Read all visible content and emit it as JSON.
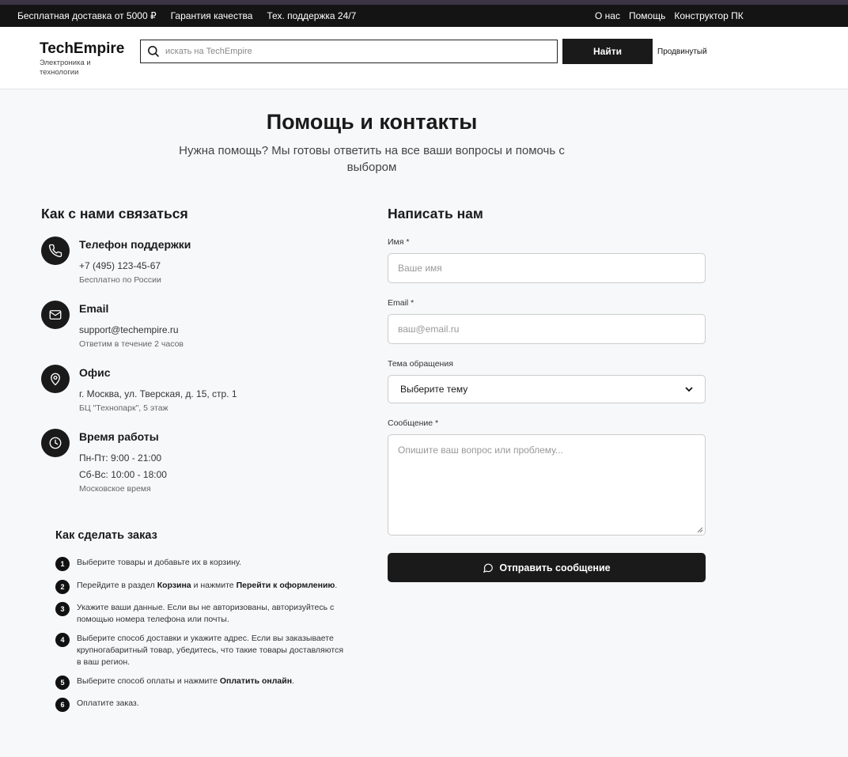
{
  "topbar": {
    "links_left": [
      "Бесплатная доставка от 5000 ₽",
      "Гарантия качества",
      "Тех. поддержка 24/7"
    ],
    "links_right": [
      "О нас",
      "Помощь",
      "Конструктор ПК"
    ]
  },
  "header": {
    "logo": "TechEmpire",
    "tagline": "Электроника и технологии",
    "search_placeholder": "искать на TechEmpire",
    "search_button": "Найти",
    "advanced_link": "Продвинутый"
  },
  "page": {
    "title": "Помощь и контакты",
    "subtitle": "Нужна помощь? Мы готовы ответить на все ваши вопросы и помочь с выбором"
  },
  "contacts": {
    "heading": "Как с нами связаться",
    "phone": {
      "icon": "phone-icon",
      "title": "Телефон поддержки",
      "value": "+7 (495) 123-45-67",
      "note": "Бесплатно по России"
    },
    "email": {
      "icon": "mail-icon",
      "title": "Email",
      "value": "support@techempire.ru",
      "note": "Ответим в течение 2 часов"
    },
    "office": {
      "icon": "map-pin-icon",
      "title": "Офис",
      "value": "г. Москва, ул. Тверская, д. 15, стр. 1",
      "note": "БЦ \"Технопарк\", 5 этаж"
    },
    "hours": {
      "icon": "clock-icon",
      "title": "Время работы",
      "line1": "Пн-Пт: 9:00 - 21:00",
      "line2": "Сб-Вс: 10:00 - 18:00",
      "note": "Московское время"
    }
  },
  "order": {
    "heading": "Как сделать заказ",
    "steps": [
      {
        "num": "1",
        "text": "Выберите товары и добавьте их в корзину."
      },
      {
        "num": "2",
        "pre": "Перейдите в раздел ",
        "b1": "Корзина",
        "mid": " и нажмите ",
        "b2": "Перейти к оформлению",
        "post": "."
      },
      {
        "num": "3",
        "text": "Укажите ваши данные. Если вы не авторизованы, авторизуйтесь с помощью номера телефона или почты."
      },
      {
        "num": "4",
        "text": "Выберите способ доставки и укажите адрес. Если вы заказываете крупногабаритный товар, убедитесь, что такие товары доставляются в ваш регион."
      },
      {
        "num": "5",
        "pre": "Выберите способ оплаты и нажмите ",
        "b1": "Оплатить онлайн",
        "post": "."
      },
      {
        "num": "6",
        "text": "Оплатите заказ."
      }
    ]
  },
  "form": {
    "heading": "Написать нам",
    "name_label": "Имя *",
    "name_placeholder": "Ваше имя",
    "email_label": "Email *",
    "email_placeholder": "ваш@email.ru",
    "topic_label": "Тема обращения",
    "topic_value": "Выберите тему",
    "message_label": "Сообщение *",
    "message_placeholder": "Опишите ваш вопрос или проблему...",
    "submit": "Отправить сообщение"
  }
}
